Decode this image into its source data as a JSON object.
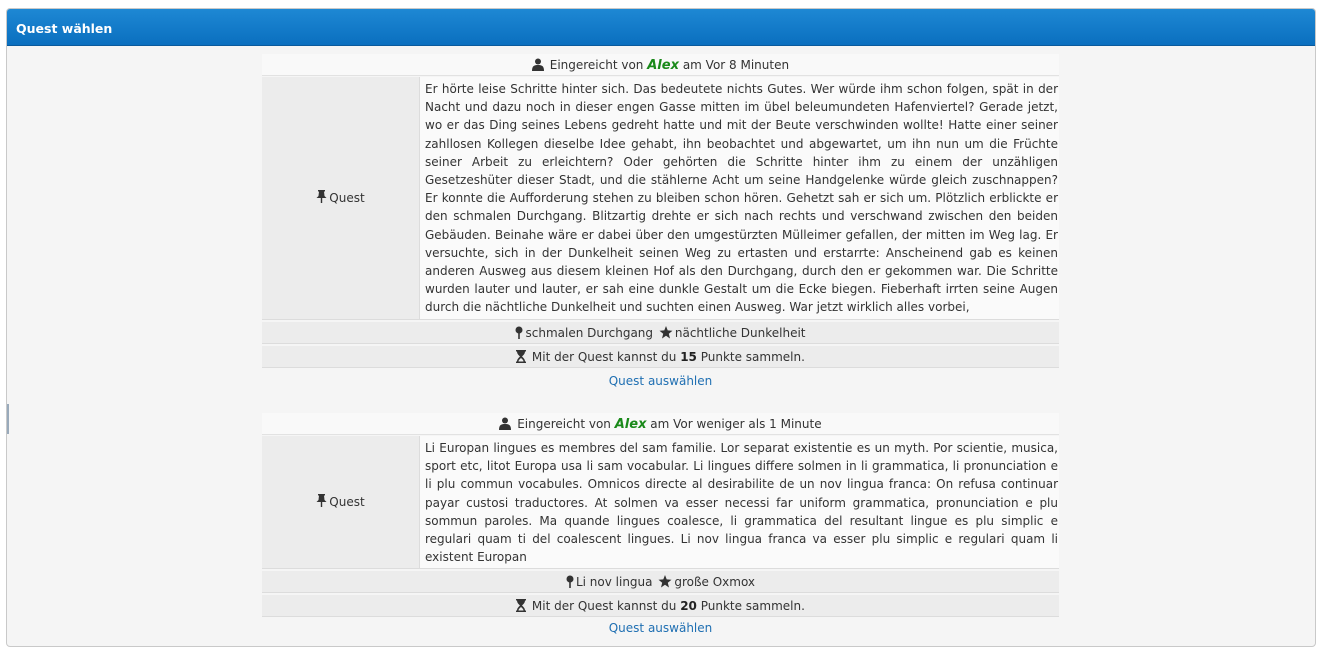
{
  "panel": {
    "title": "Quest wählen"
  },
  "quests": [
    {
      "submitted_prefix": "Eingereicht von",
      "author": "Alex",
      "time_text": "am Vor 8 Minuten",
      "label": "Quest",
      "text": "Er hörte leise Schritte hinter sich. Das bedeutete nichts Gutes. Wer würde ihm schon folgen, spät in der Nacht und dazu noch in dieser engen Gasse mitten im übel beleumundeten Hafenviertel? Gerade jetzt, wo er das Ding seines Lebens gedreht hatte und mit der Beute verschwinden wollte! Hatte einer seiner zahllosen Kollegen dieselbe Idee gehabt, ihn beobachtet und abgewartet, um ihn nun um die Früchte seiner Arbeit zu erleichtern? Oder gehörten die Schritte hinter ihm zu einem der unzähligen Gesetzeshüter dieser Stadt, und die stählerne Acht um seine Handgelenke würde gleich zuschnappen? Er konnte die Aufforderung stehen zu bleiben schon hören. Gehetzt sah er sich um. Plötzlich erblickte er den schmalen Durchgang. Blitzartig drehte er sich nach rechts und verschwand zwischen den beiden Gebäuden. Beinahe wäre er dabei über den umgestürzten Mülleimer gefallen, der mitten im Weg lag. Er versuchte, sich in der Dunkelheit seinen Weg zu ertasten und erstarrte: Anscheinend gab es keinen anderen Ausweg aus diesem kleinen Hof als den Durchgang, durch den er gekommen war. Die Schritte wurden lauter und lauter, er sah eine dunkle Gestalt um die Ecke biegen. Fieberhaft irrten seine Augen durch die nächtliche Dunkelheit und suchten einen Ausweg. War jetzt wirklich alles vorbei,",
      "location": "schmalen Durchgang",
      "item": "nächtliche Dunkelheit",
      "points_prefix": "Mit der Quest kannst du",
      "points": "15",
      "points_suffix": "Punkte sammeln.",
      "select_label": "Quest auswählen"
    },
    {
      "submitted_prefix": "Eingereicht von",
      "author": "Alex",
      "time_text": "am Vor weniger als 1 Minute",
      "label": "Quest",
      "text": "Li Europan lingues es membres del sam familie. Lor separat existentie es un myth. Por scientie, musica, sport etc, litot Europa usa li sam vocabular. Li lingues differe solmen in li grammatica, li pronunciation e li plu commun vocabules. Omnicos directe al desirabilite de un nov lingua franca: On refusa continuar payar custosi traductores. At solmen va esser necessi far uniform grammatica, pronunciation e plu sommun paroles. Ma quande lingues coalesce, li grammatica del resultant lingue es plu simplic e regulari quam ti del coalescent lingues. Li nov lingua franca va esser plu simplic e regulari quam li existent Europan",
      "location": "Li nov lingua",
      "item": "große Oxmox",
      "points_prefix": "Mit der Quest kannst du",
      "points": "20",
      "points_suffix": "Punkte sammeln.",
      "select_label": "Quest auswählen"
    }
  ]
}
